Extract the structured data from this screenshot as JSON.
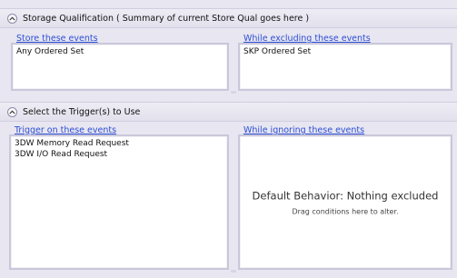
{
  "storage_section": {
    "title": "Storage Qualification ( Summary of current Store Qual goes here )",
    "store_pane": {
      "label": "Store these events",
      "items": [
        "Any Ordered Set"
      ]
    },
    "exclude_pane": {
      "label": "While excluding these events",
      "items": [
        "SKP Ordered Set"
      ]
    }
  },
  "trigger_section": {
    "title": "Select the Trigger(s) to Use",
    "trigger_pane": {
      "label": "Trigger on these events",
      "items": [
        "3DW Memory Read Request",
        "3DW I/O Read Request"
      ]
    },
    "ignore_pane": {
      "label": "While ignoring these events",
      "empty_title": "Default Behavior: Nothing excluded",
      "empty_hint": "Drag conditions here to alter."
    }
  },
  "icons": {
    "collapse": "chevron-up-icon"
  }
}
